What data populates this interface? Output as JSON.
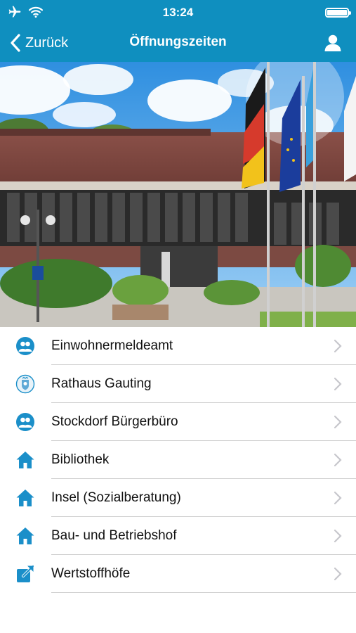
{
  "status_bar": {
    "time": "13:24"
  },
  "nav": {
    "back_label": "Zurück",
    "title": "Öffnungszeiten",
    "accent_color": "#0f8fbf"
  },
  "menu": {
    "items": [
      {
        "label": "Einwohnermeldeamt",
        "icon": "people-icon"
      },
      {
        "label": "Rathaus Gauting",
        "icon": "crest-icon"
      },
      {
        "label": "Stockdorf Bürgerbüro",
        "icon": "people-icon"
      },
      {
        "label": "Bibliothek",
        "icon": "home-icon"
      },
      {
        "label": "Insel (Sozialberatung)",
        "icon": "home-icon"
      },
      {
        "label": "Bau- und Betriebshof",
        "icon": "home-icon"
      },
      {
        "label": "Wertstoffhöfe",
        "icon": "external-link-icon"
      }
    ]
  }
}
